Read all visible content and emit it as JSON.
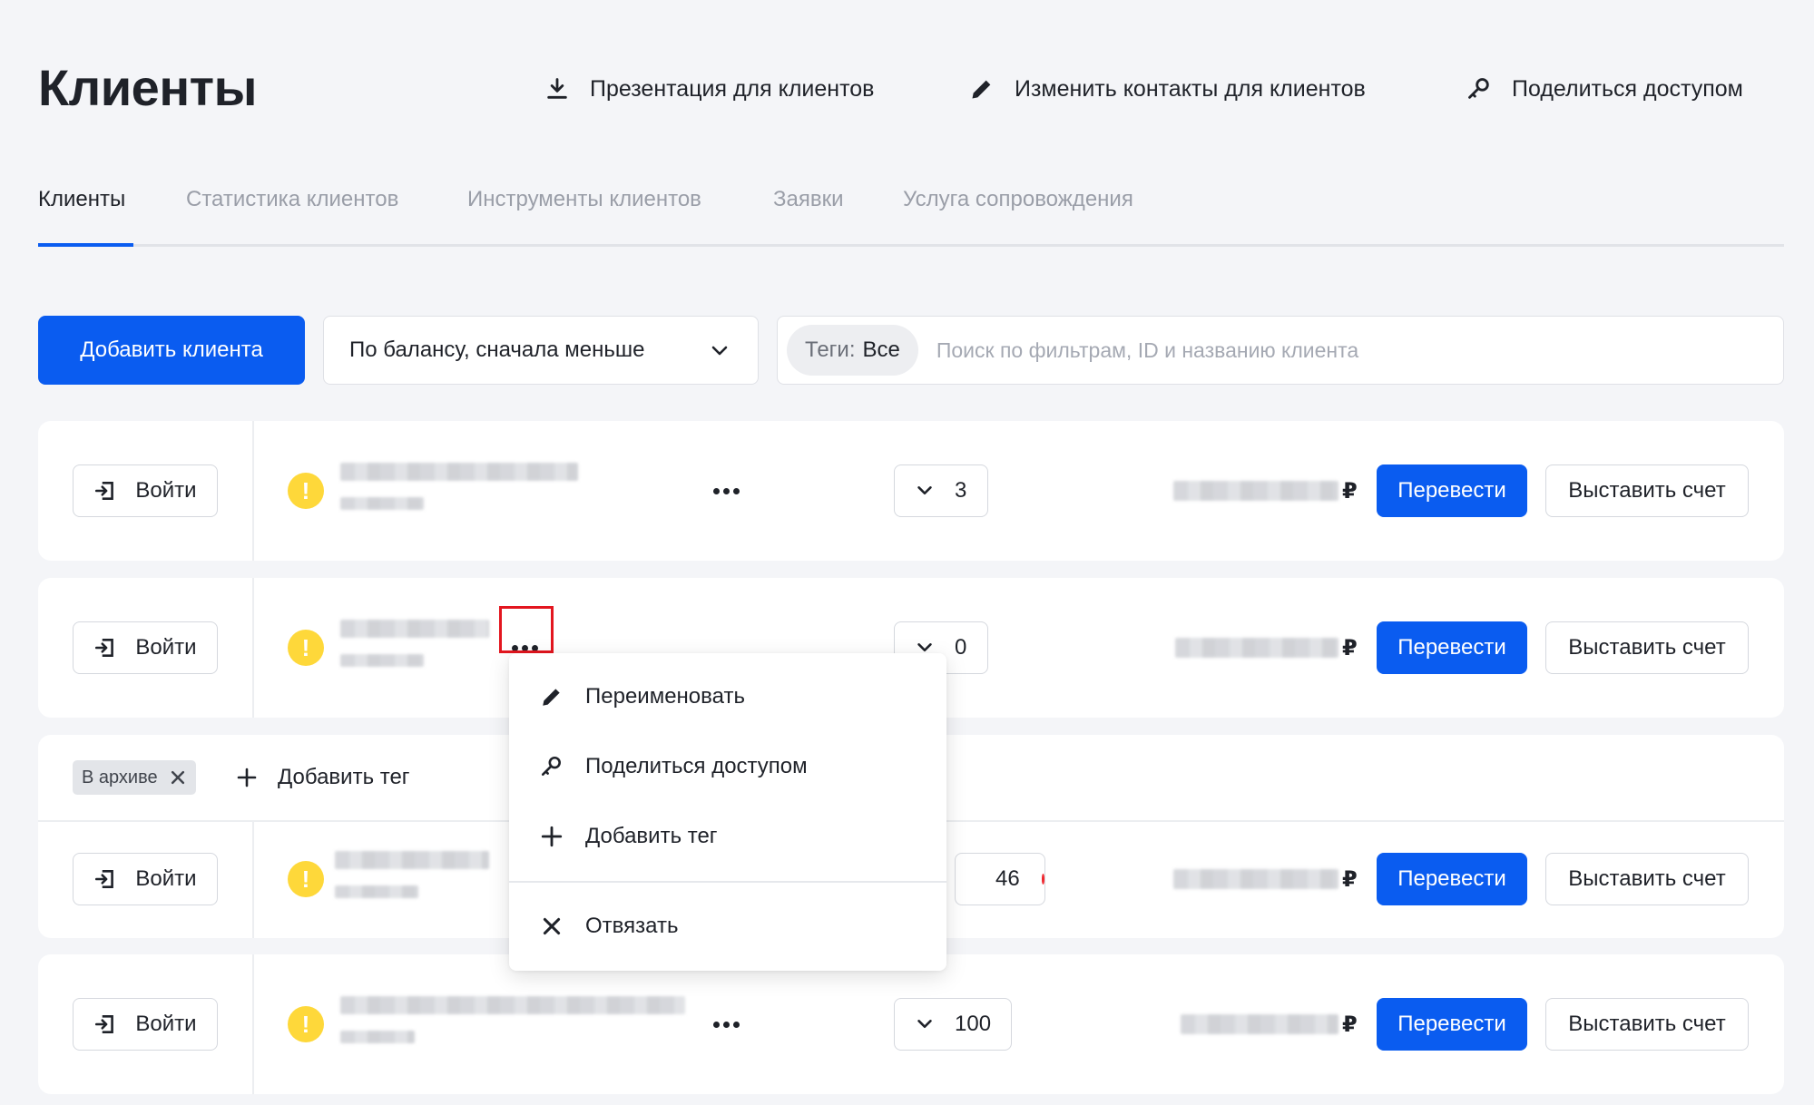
{
  "header": {
    "title": "Клиенты",
    "actions": [
      {
        "label": "Презентация для клиентов",
        "icon": "download-icon"
      },
      {
        "label": "Изменить контакты для клиентов",
        "icon": "pencil-icon"
      },
      {
        "label": "Поделиться доступом",
        "icon": "key-icon"
      }
    ]
  },
  "tabs": [
    {
      "label": "Клиенты",
      "active": true
    },
    {
      "label": "Статистика клиентов",
      "active": false
    },
    {
      "label": "Инструменты клиентов",
      "active": false
    },
    {
      "label": "Заявки",
      "active": false
    },
    {
      "label": "Услуга сопровождения",
      "active": false
    }
  ],
  "toolbar": {
    "add_client_label": "Добавить клиента",
    "sort_value": "По балансу, сначала меньше",
    "tag_filter_key": "Теги:",
    "tag_filter_value": "Все",
    "search_placeholder": "Поиск по фильтрам, ID и названию клиента"
  },
  "clients": [
    {
      "login_label": "Войти",
      "warning": "!",
      "counter": "3",
      "currency": "₽",
      "transfer_label": "Перевести",
      "invoice_label": "Выставить счет"
    },
    {
      "login_label": "Войти",
      "warning": "!",
      "counter": "0",
      "currency": "₽",
      "transfer_label": "Перевести",
      "invoice_label": "Выставить счет"
    },
    {
      "login_label": "Войти",
      "warning": "!",
      "counter": "46",
      "currency": "₽",
      "transfer_label": "Перевести",
      "invoice_label": "Выставить счет",
      "tags": [
        "В архиве"
      ],
      "add_tag_label": "Добавить тег"
    },
    {
      "login_label": "Войти",
      "warning": "!",
      "counter": "100",
      "currency": "₽",
      "transfer_label": "Перевести",
      "invoice_label": "Выставить счет"
    }
  ],
  "context_menu": {
    "items": [
      {
        "label": "Переименовать",
        "icon": "pencil-icon"
      },
      {
        "label": "Поделиться доступом",
        "icon": "key-icon"
      },
      {
        "label": "Добавить тег",
        "icon": "plus-icon"
      },
      {
        "label": "Отвязать",
        "icon": "close-icon"
      }
    ]
  },
  "colors": {
    "accent": "#0a5cf0",
    "warning": "#fed83a",
    "alert_dot": "#f0262d",
    "highlight": "#e3161f",
    "background": "#f4f5f8"
  }
}
